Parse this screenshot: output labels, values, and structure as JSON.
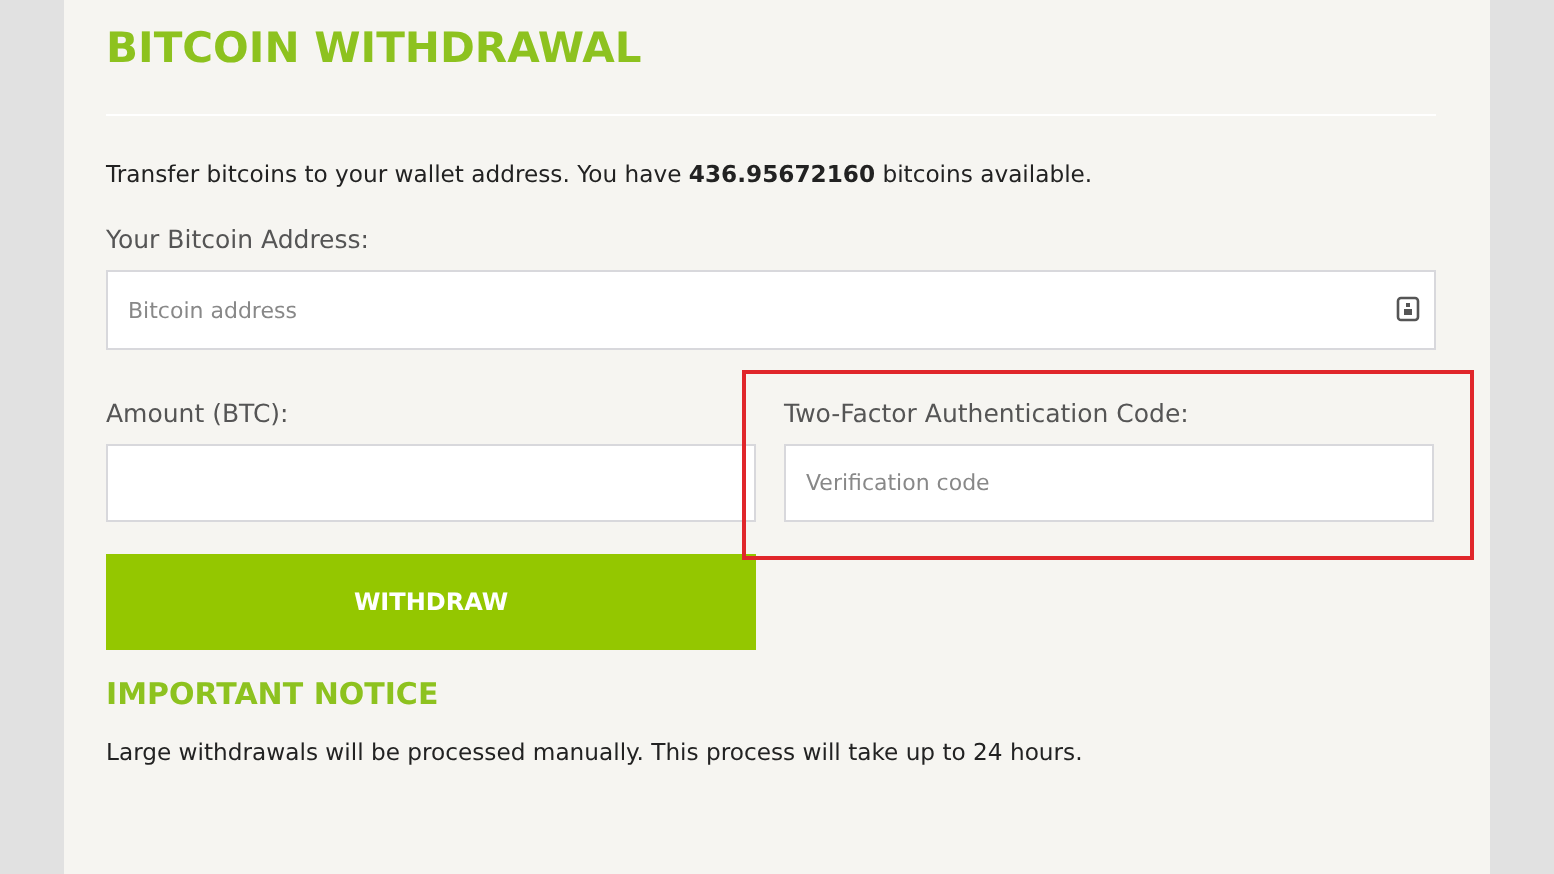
{
  "title": "BITCOIN WITHDRAWAL",
  "intro": "Transfer bitcoins to your wallet address. You have **436.95672160** bitcoins available.",
  "address": {
    "label": "Your Bitcoin Address:",
    "placeholder": "Bitcoin address"
  },
  "amount": {
    "label": "Amount (BTC):"
  },
  "two_factor": {
    "label": "Two-Factor Authentication Code:",
    "placeholder": "Verification code",
    "highlighted": true
  },
  "button": "WITHDRAW",
  "notice": {
    "title": "IMPORTANT NOTICE",
    "text": "Large withdrawals will be processed manually. This process will take up to 24 hours."
  }
}
